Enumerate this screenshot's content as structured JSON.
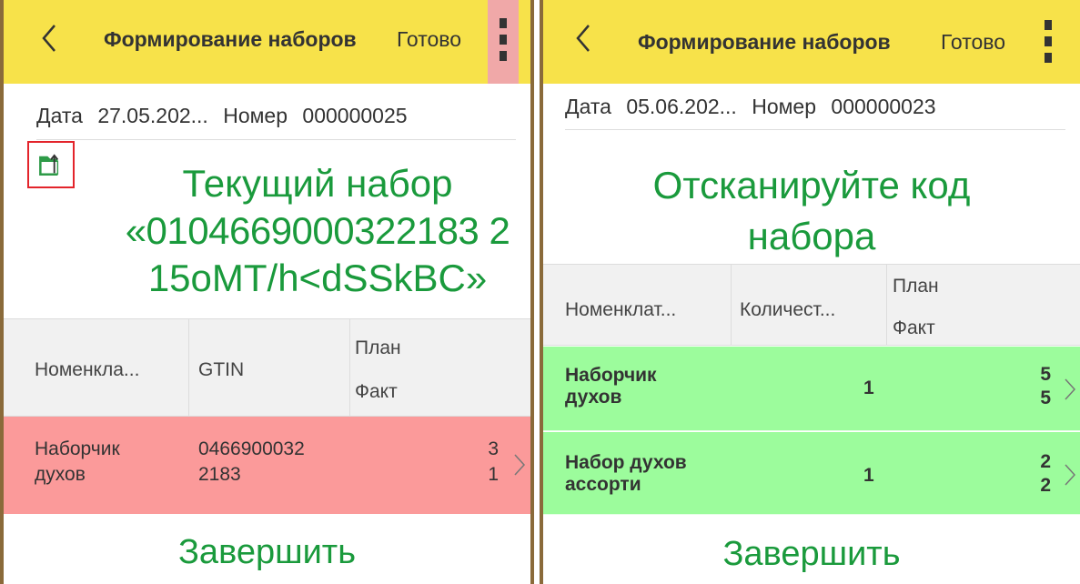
{
  "left": {
    "title": "Формирование наборов",
    "done": "Готово",
    "date_label": "Дата",
    "date_value": "27.05.202...",
    "number_label": "Номер",
    "number_value": "000000025",
    "current_set_lines": [
      "Текущий набор",
      "«0104669000322183 2",
      "15oMT/h<dSSkBC»"
    ],
    "columns": {
      "name": "Номенкла...",
      "gtin": "GTIN",
      "plan": "План",
      "fact": "Факт"
    },
    "rows": [
      {
        "name_line1": "Наборчик",
        "name_line2": "духов",
        "gtin_line1": "0466900032",
        "gtin_line2": "2183",
        "plan": "3",
        "fact": "1"
      }
    ],
    "finish": "Завершить"
  },
  "right": {
    "title": "Формирование наборов",
    "done": "Готово",
    "date_label": "Дата",
    "date_value": "05.06.202...",
    "number_label": "Номер",
    "number_value": "000000023",
    "scan_lines": [
      "Отсканируйте код",
      "набора"
    ],
    "columns": {
      "name": "Номенклат...",
      "qty": "Количест...",
      "plan": "План",
      "fact": "Факт"
    },
    "rows": [
      {
        "name_line1": "Наборчик",
        "name_line2": "духов",
        "qty": "1",
        "plan": "5",
        "fact": "5"
      },
      {
        "name_line1": "Набор духов",
        "name_line2": "ассорти",
        "qty": "1",
        "plan": "2",
        "fact": "2"
      }
    ],
    "finish": "Завершить"
  },
  "colors": {
    "header": "#f7e24a",
    "accent_green": "#1a9a3c",
    "row_red": "#fb9a9a",
    "row_green": "#9cfc9c",
    "highlight_red": "#e3242b"
  },
  "icons": [
    "back-arrow-icon",
    "more-vert-icon",
    "folder-upload-icon",
    "chevron-right-icon"
  ]
}
